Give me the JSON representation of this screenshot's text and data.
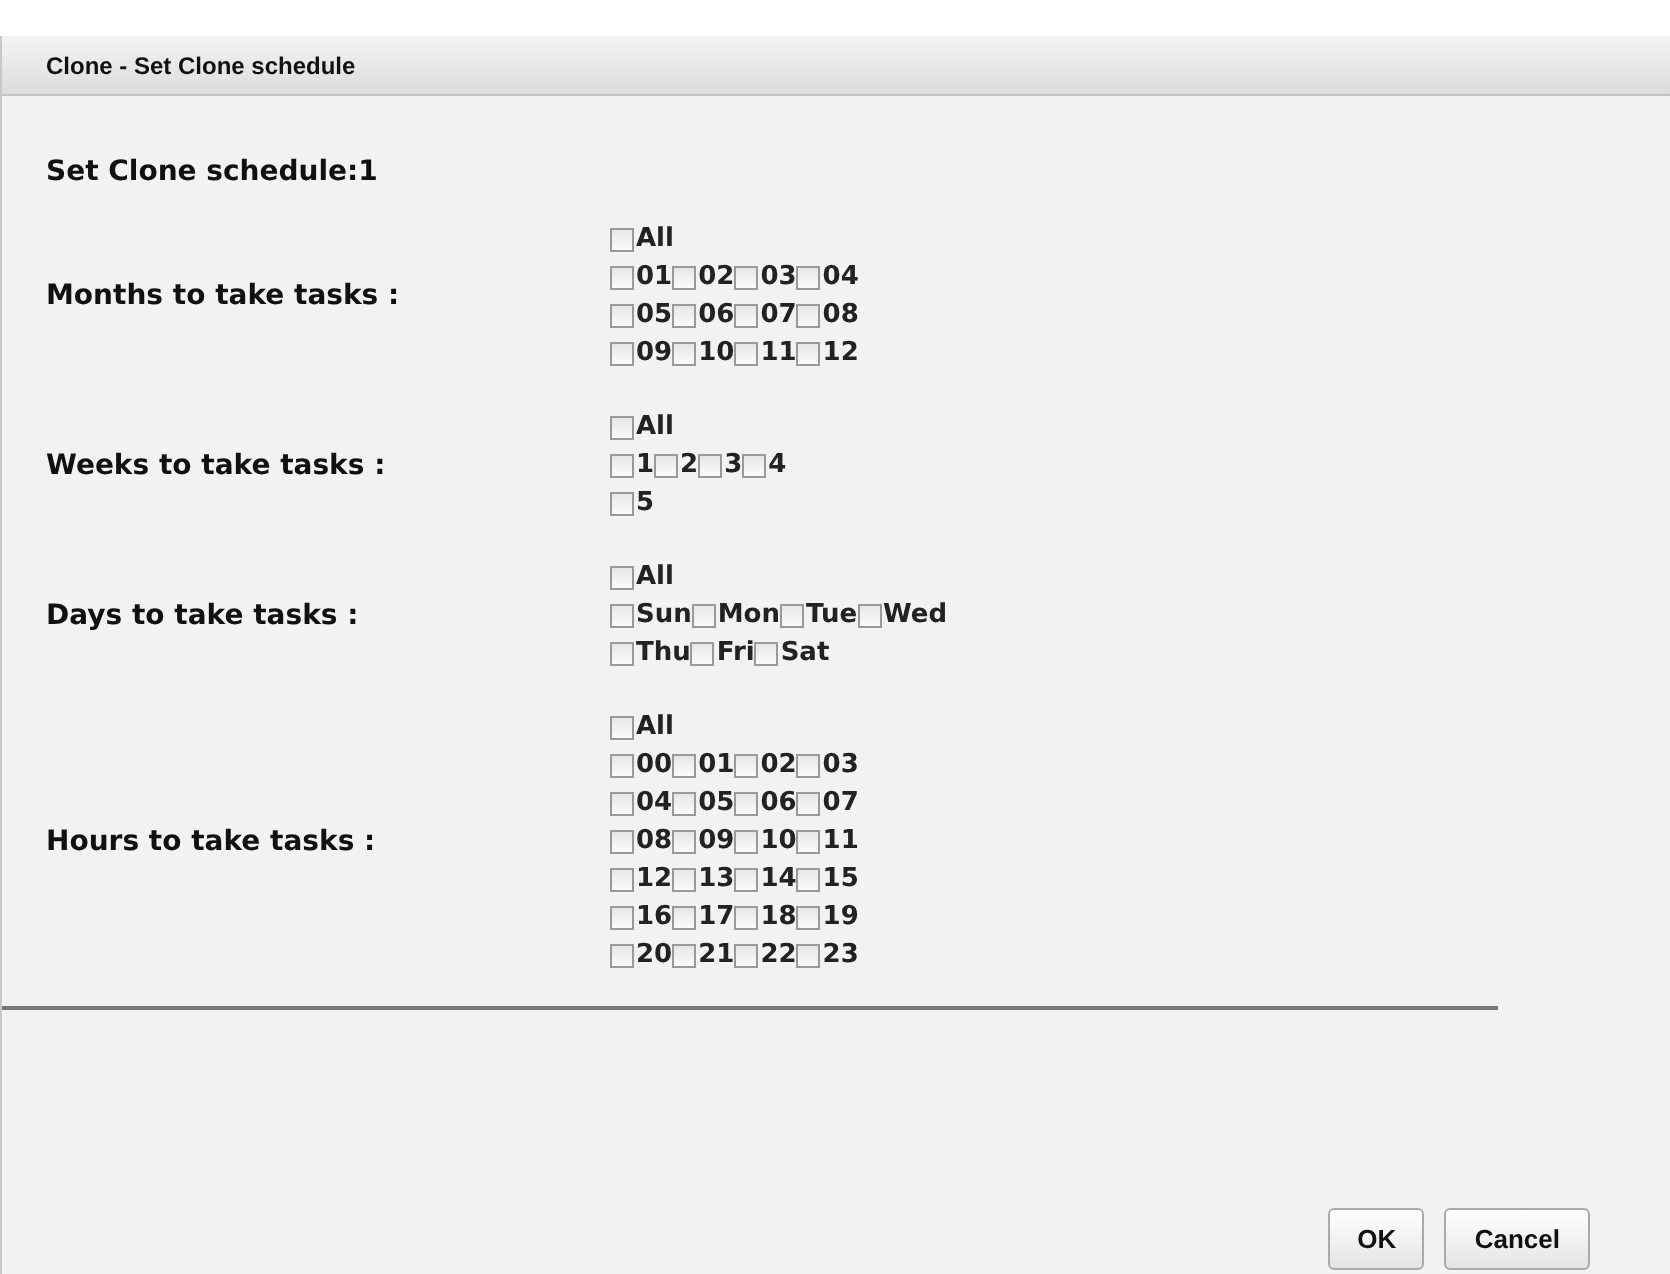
{
  "window": {
    "title": "Clone - Set Clone schedule"
  },
  "heading": "Set Clone schedule:1",
  "sections": [
    {
      "label": "Months to take tasks :",
      "all": {
        "label": "All",
        "checked": false
      },
      "options": [
        {
          "label": "01",
          "checked": false
        },
        {
          "label": "02",
          "checked": false
        },
        {
          "label": "03",
          "checked": false
        },
        {
          "label": "04",
          "checked": false
        },
        {
          "label": "05",
          "checked": false
        },
        {
          "label": "06",
          "checked": false
        },
        {
          "label": "07",
          "checked": false
        },
        {
          "label": "08",
          "checked": false
        },
        {
          "label": "09",
          "checked": false
        },
        {
          "label": "10",
          "checked": false
        },
        {
          "label": "11",
          "checked": false
        },
        {
          "label": "12",
          "checked": false
        }
      ]
    },
    {
      "label": "Weeks to take tasks :",
      "all": {
        "label": "All",
        "checked": false
      },
      "options": [
        {
          "label": "1",
          "checked": false
        },
        {
          "label": "2",
          "checked": false
        },
        {
          "label": "3",
          "checked": false
        },
        {
          "label": "4",
          "checked": false
        },
        {
          "label": "5",
          "checked": false
        }
      ]
    },
    {
      "label": "Days to take tasks :",
      "all": {
        "label": "All",
        "checked": false
      },
      "options": [
        {
          "label": "Sun",
          "checked": false
        },
        {
          "label": "Mon",
          "checked": false
        },
        {
          "label": "Tue",
          "checked": false
        },
        {
          "label": "Wed",
          "checked": false
        },
        {
          "label": "Thu",
          "checked": false
        },
        {
          "label": "Fri",
          "checked": false
        },
        {
          "label": "Sat",
          "checked": false
        }
      ]
    },
    {
      "label": "Hours to take tasks :",
      "all": {
        "label": "All",
        "checked": false
      },
      "options": [
        {
          "label": "00",
          "checked": false
        },
        {
          "label": "01",
          "checked": false
        },
        {
          "label": "02",
          "checked": false
        },
        {
          "label": "03",
          "checked": false
        },
        {
          "label": "04",
          "checked": false
        },
        {
          "label": "05",
          "checked": false
        },
        {
          "label": "06",
          "checked": false
        },
        {
          "label": "07",
          "checked": false
        },
        {
          "label": "08",
          "checked": false
        },
        {
          "label": "09",
          "checked": false
        },
        {
          "label": "10",
          "checked": false
        },
        {
          "label": "11",
          "checked": false
        },
        {
          "label": "12",
          "checked": false
        },
        {
          "label": "13",
          "checked": false
        },
        {
          "label": "14",
          "checked": false
        },
        {
          "label": "15",
          "checked": false
        },
        {
          "label": "16",
          "checked": false
        },
        {
          "label": "17",
          "checked": false
        },
        {
          "label": "18",
          "checked": false
        },
        {
          "label": "19",
          "checked": false
        },
        {
          "label": "20",
          "checked": false
        },
        {
          "label": "21",
          "checked": false
        },
        {
          "label": "22",
          "checked": false
        },
        {
          "label": "23",
          "checked": false
        }
      ]
    }
  ],
  "buttons": [
    {
      "label": "OK"
    },
    {
      "label": "Cancel"
    }
  ]
}
